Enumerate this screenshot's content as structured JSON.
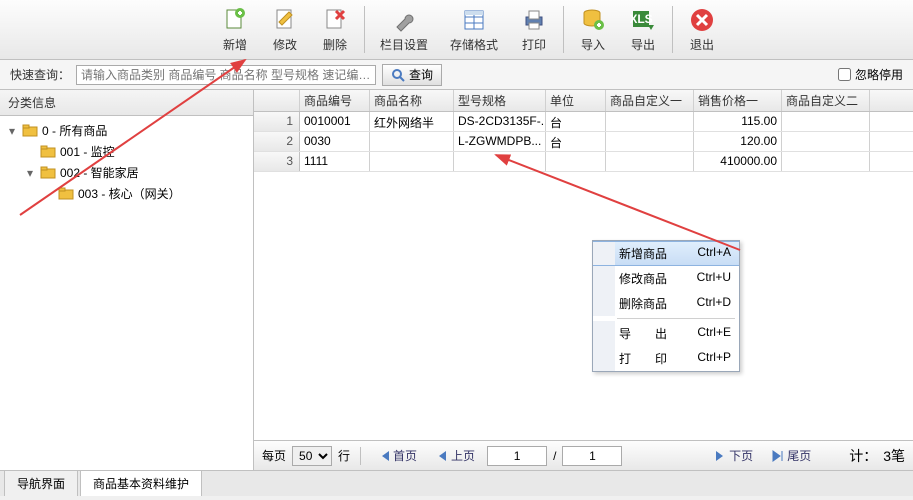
{
  "toolbar": {
    "add": "新增",
    "edit": "修改",
    "delete": "删除",
    "column_settings": "栏目设置",
    "save_format": "存储格式",
    "print": "打印",
    "import": "导入",
    "export": "导出",
    "exit": "退出"
  },
  "search": {
    "label": "快速查询：",
    "placeholder": "请输入商品类别 商品编号 商品名称 型号规格 速记编…",
    "button": "查询",
    "ignore_disabled_label": "忽略停用"
  },
  "sidebar": {
    "title": "分类信息",
    "nodes": {
      "root": "0 - 所有商品",
      "n1": "001 - 监控",
      "n2": "002 - 智能家居",
      "n3": "003 - 核心（网关）"
    }
  },
  "grid": {
    "headers": {
      "code": "商品编号",
      "name": "商品名称",
      "spec": "型号规格",
      "unit": "单位",
      "custom1": "商品自定义一",
      "price1": "销售价格一",
      "custom2": "商品自定义二"
    },
    "rows": [
      {
        "num": "1",
        "code": "0010001",
        "name": "红外网络半",
        "spec": "DS-2CD3135F-...",
        "unit": "台",
        "custom1": "",
        "price1": "115.00",
        "custom2": ""
      },
      {
        "num": "2",
        "code": "0030",
        "name": "",
        "spec": "L-ZGWMDPB...",
        "unit": "台",
        "custom1": "",
        "price1": "120.00",
        "custom2": ""
      },
      {
        "num": "3",
        "code": "1111",
        "name": "",
        "spec": "",
        "unit": "",
        "custom1": "",
        "price1": "410000.00",
        "custom2": ""
      }
    ]
  },
  "context_menu": {
    "add": {
      "label": "新增商品",
      "shortcut": "Ctrl+A"
    },
    "edit": {
      "label": "修改商品",
      "shortcut": "Ctrl+U"
    },
    "delete": {
      "label": "删除商品",
      "shortcut": "Ctrl+D"
    },
    "export": {
      "label": "导　　出",
      "shortcut": "Ctrl+E"
    },
    "print": {
      "label": "打　　印",
      "shortcut": "Ctrl+P"
    }
  },
  "pager": {
    "per_page_label": "每页",
    "per_page_value": "50",
    "row_label": "行",
    "first": "首页",
    "prev": "上页",
    "current_page": "1",
    "sep": "/",
    "total_pages": "1",
    "next": "下页",
    "last": "尾页",
    "total_label": "计：",
    "total_value": "3笔"
  },
  "tabs": {
    "nav": "导航界面",
    "product": "商品基本资料维护"
  }
}
